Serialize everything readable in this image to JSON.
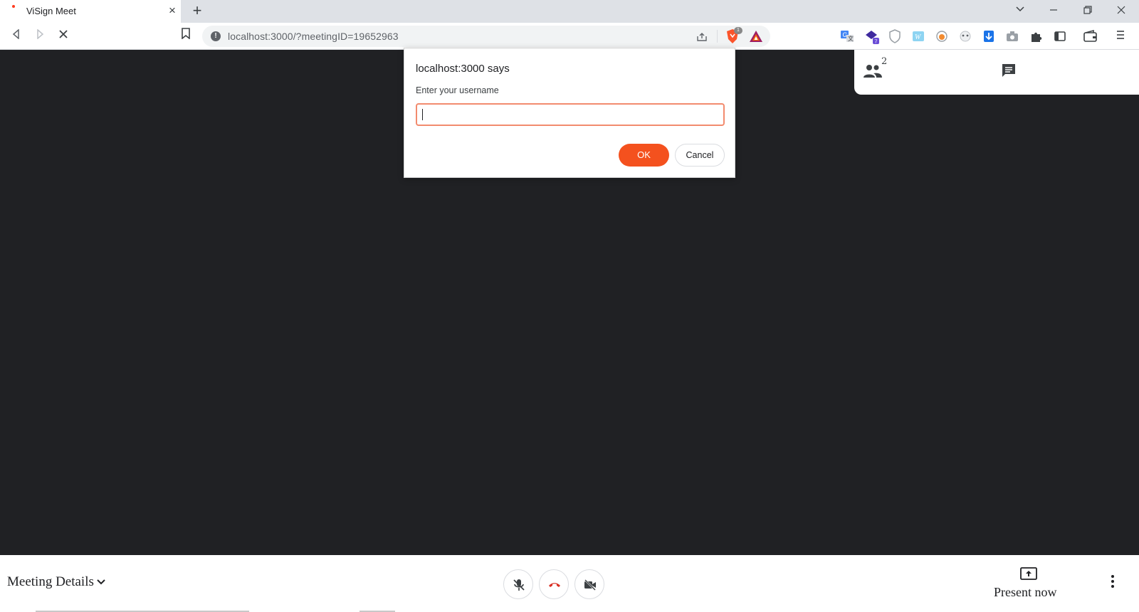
{
  "browser": {
    "tab_title": "ViSign Meet",
    "tab_close_glyph": "×",
    "new_tab_glyph": "+",
    "url": "localhost:3000/?meetingID=19652963",
    "info_glyph": "!",
    "brave_badge": "1",
    "window_controls": {
      "menu": "⌄",
      "minimize": "–",
      "restore": "❐",
      "close": "✕"
    },
    "nav": {
      "back": "◁",
      "forward": "▷",
      "stop": "✕"
    },
    "extensions": [
      "translate-icon",
      "extension-badge-icon",
      "shield-icon",
      "wiki-icon",
      "orange-extension-icon",
      "panda-icon",
      "download-icon",
      "camera-icon",
      "puzzle-icon",
      "sidebar-icon",
      "wallet-icon",
      "menu-icon"
    ],
    "brand_color": "#fb542b"
  },
  "side_panel": {
    "participant_count": "2"
  },
  "dialog": {
    "title": "localhost:3000 says",
    "message": "Enter your username",
    "input_value": "",
    "ok_label": "OK",
    "cancel_label": "Cancel",
    "accent_color": "#f4511e"
  },
  "bottom_bar": {
    "meeting_details_label": "Meeting Details",
    "present_label": "Present now",
    "end_call_color": "#d93025"
  }
}
